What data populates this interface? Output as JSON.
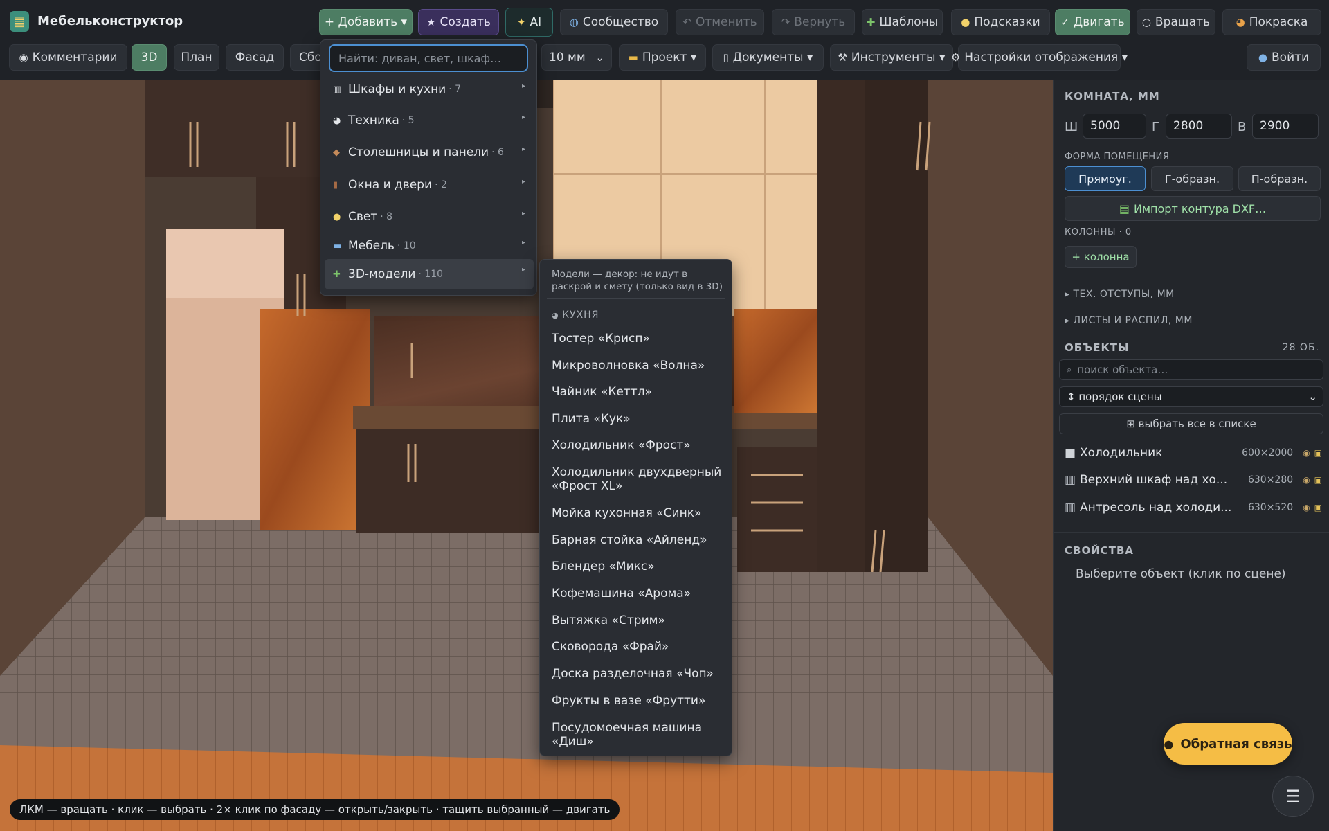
{
  "app": {
    "title": "Мебельконструктор",
    "logo_icon": "cabinet-logo-icon"
  },
  "toolbar_row1": {
    "add": "+ Добавить ▾",
    "create": "Создать",
    "ai": "AI",
    "community": "Сообщество",
    "undo": "Отменить",
    "redo": "Вернуть",
    "templates": "Шаблоны",
    "hints": "Подсказки",
    "move": "Двигать",
    "rotate": "Вращать",
    "paint": "Покраска"
  },
  "toolbar_row2": {
    "comments": "Комментарии",
    "view_3d": "3D",
    "view_plan": "План",
    "view_facade": "Фасад",
    "view_assembly": "Сбо",
    "step": "10 мм",
    "project": "Проект ▾",
    "documents": "Документы ▾",
    "tools": "Инструменты ▾",
    "display_settings": "Настройки отображения ▾",
    "login": "Войти"
  },
  "add_menu": {
    "search_placeholder": "Найти: диван, свет, шкаф…",
    "items": [
      {
        "label": "Шкафы и кухни",
        "count": "· 7",
        "icon": "cabinet-icon"
      },
      {
        "label": "Техника",
        "count": "· 5",
        "icon": "appliance-icon"
      },
      {
        "label": "Столешницы и панели",
        "count": "· 6",
        "icon": "countertop-icon"
      },
      {
        "label": "Окна и двери",
        "count": "· 2",
        "icon": "door-icon"
      },
      {
        "label": "Свет",
        "count": "· 8",
        "icon": "lightbulb-icon"
      },
      {
        "label": "Мебель",
        "count": "· 10",
        "icon": "sofa-icon"
      },
      {
        "label": "3D-модели",
        "count": "· 110",
        "icon": "puzzle-icon"
      }
    ]
  },
  "submenu": {
    "note": "Модели — декор: не идут в раскрой и смету (только вид в 3D)",
    "category": "КУХНЯ",
    "items": [
      "Тостер «Крисп»",
      "Микроволновка «Волна»",
      "Чайник «Кеттл»",
      "Плита «Кук»",
      "Холодильник «Фрост»",
      "Холодильник двухдверный «Фрост XL»",
      "Мойка кухонная «Синк»",
      "Барная стойка «Айленд»",
      "Блендер «Микс»",
      "Кофемашина «Арома»",
      "Вытяжка «Стрим»",
      "Сковорода «Фрай»",
      "Доска разделочная «Чоп»",
      "Фрукты в вазе «Фрутти»",
      "Посудомоечная машина «Диш»"
    ]
  },
  "sidebar": {
    "room_title": "КОМНАТА, ММ",
    "w_label": "Ш",
    "w_value": "5000",
    "d_label": "Г",
    "d_value": "2800",
    "h_label": "В",
    "h_value": "2900",
    "shape_title": "ФОРМА ПОМЕЩЕНИЯ",
    "shape_rect": "Прямоуг.",
    "shape_l": "Г-образн.",
    "shape_u": "П-образн.",
    "import_dxf": "Импорт контура DXF…",
    "columns_title": "КОЛОННЫ · 0",
    "add_column": "+ колонна",
    "tech_offsets": "ТЕХ. ОТСТУПЫ, ММ",
    "sheets": "ЛИСТЫ И РАСПИЛ, ММ",
    "objects_title": "ОБЪЕКТЫ",
    "objects_count": "28 ОБ.",
    "object_search_placeholder": "поиск объекта…",
    "sort_value": "↕ порядок сцены",
    "select_all": "⊞ выбрать все в списке",
    "objects": [
      {
        "name": "Холодильник",
        "size": "600×2000"
      },
      {
        "name": "Верхний шкаф над хо...",
        "size": "630×280"
      },
      {
        "name": "Антресоль над холоди...",
        "size": "630×520"
      }
    ],
    "props_title": "СВОЙСТВА",
    "props_hint": "Выберите объект (клик по сцене)"
  },
  "hint_bar": "ЛКМ — вращать · клик — выбрать · 2× клик по фасаду — открыть/закрыть · тащить выбранный — двигать",
  "feedback": "Обратная связь",
  "menu_fab": "☰",
  "colors": {
    "accent_green": "#4d7d63",
    "accent_blue": "#4c8fd1",
    "feedback_yellow": "#f5bd45",
    "wood": "#b8622c"
  }
}
